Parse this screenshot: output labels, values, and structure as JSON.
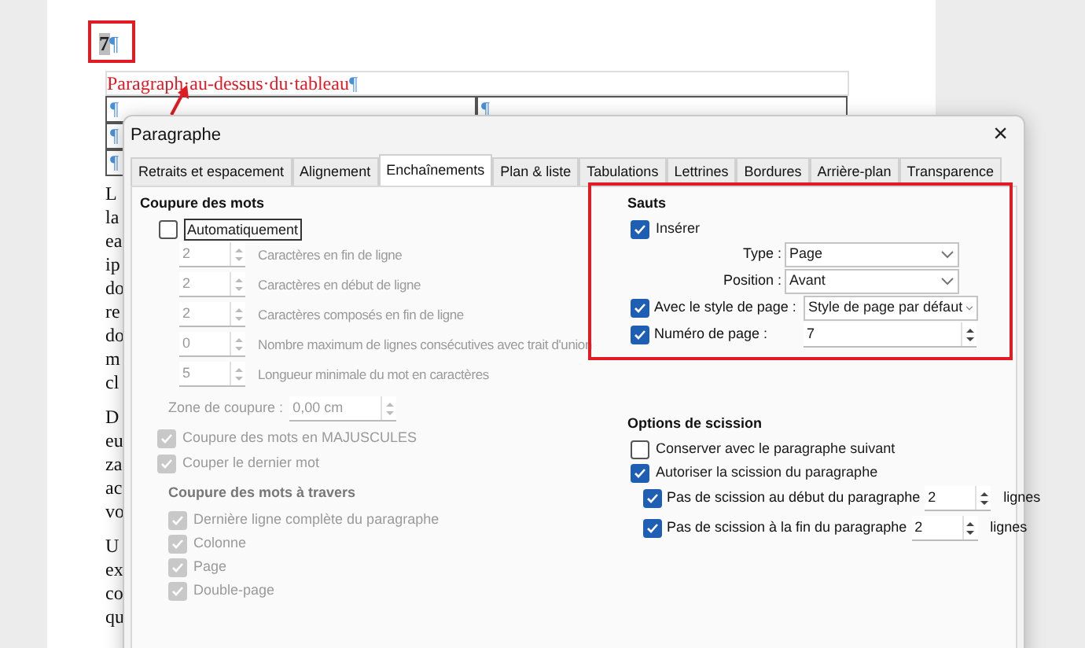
{
  "document": {
    "page_number": "7",
    "pilcrow": "¶",
    "heading": "Paragraph·au-dessus·du·tableau",
    "table_rows": [
      [
        "¶",
        "¶"
      ],
      [
        "¶"
      ],
      [
        "¶"
      ]
    ],
    "paragraphs": [
      [
        "L",
        "la",
        "ea",
        "ip",
        "do",
        "re",
        "do",
        "m",
        "cl"
      ],
      [
        "D",
        "eu",
        "za",
        "ac",
        "vo"
      ],
      [
        "U",
        "ex",
        "co",
        "qu"
      ]
    ]
  },
  "dialog": {
    "title": "Paragraphe",
    "close": "×",
    "tabs": [
      {
        "label": "Retraits et espacement",
        "selected": false
      },
      {
        "label": "Alignement",
        "selected": false
      },
      {
        "label": "Enchaînements",
        "selected": true
      },
      {
        "label": "Plan & liste",
        "selected": false
      },
      {
        "label": "Tabulations",
        "selected": false
      },
      {
        "label": "Lettrines",
        "selected": false
      },
      {
        "label": "Bordures",
        "selected": false
      },
      {
        "label": "Arrière-plan",
        "selected": false
      },
      {
        "label": "Transparence",
        "selected": false
      }
    ],
    "hyphenation": {
      "title": "Coupure des mots",
      "auto": {
        "label": "Automatiquement",
        "checked": false
      },
      "spins": [
        {
          "value": "2",
          "label": "Caractères en fin de ligne",
          "disabled": true
        },
        {
          "value": "2",
          "label": "Caractères en début de ligne",
          "disabled": true
        },
        {
          "value": "2",
          "label": "Caractères composés en fin de ligne",
          "disabled": true
        },
        {
          "value": "0",
          "label": "Nombre maximum de lignes consécutives avec trait d'union",
          "disabled": true
        },
        {
          "value": "5",
          "label": "Longueur minimale du mot en caractères",
          "disabled": true
        }
      ],
      "zone": {
        "label": "Zone de coupure :",
        "value": "0,00 cm",
        "disabled": true
      },
      "checks": [
        {
          "label": "Coupure des mots en MAJUSCULES",
          "checked": true,
          "disabled": true
        },
        {
          "label": "Couper le dernier mot",
          "checked": true,
          "disabled": true
        }
      ],
      "across_title": "Coupure des mots à travers",
      "across": [
        {
          "label": "Dernière ligne complète du paragraphe",
          "checked": true,
          "disabled": true
        },
        {
          "label": "Colonne",
          "checked": true,
          "disabled": true
        },
        {
          "label": "Page",
          "checked": true,
          "disabled": true
        },
        {
          "label": "Double-page",
          "checked": true,
          "disabled": true
        }
      ]
    },
    "breaks": {
      "title": "Sauts",
      "insert": {
        "label": "Insérer",
        "checked": true
      },
      "type": {
        "label": "Type :",
        "value": "Page"
      },
      "position": {
        "label": "Position :",
        "value": "Avant"
      },
      "page_style": {
        "label": "Avec le style de page :",
        "checked": true,
        "value": "Style de page par défaut"
      },
      "page_number": {
        "label": "Numéro de page :",
        "checked": true,
        "value": "7"
      }
    },
    "split": {
      "title": "Options de scission",
      "keep": {
        "label": "Conserver avec le paragraphe suivant",
        "checked": false
      },
      "allow": {
        "label": "Autoriser la scission du paragraphe",
        "checked": true
      },
      "rows": [
        {
          "label": "Pas de scission au début du paragraphe",
          "checked": true,
          "value": "2",
          "unit": "lignes"
        },
        {
          "label": "Pas de scission à la fin du paragraphe",
          "checked": true,
          "value": "2",
          "unit": "lignes"
        }
      ]
    }
  }
}
